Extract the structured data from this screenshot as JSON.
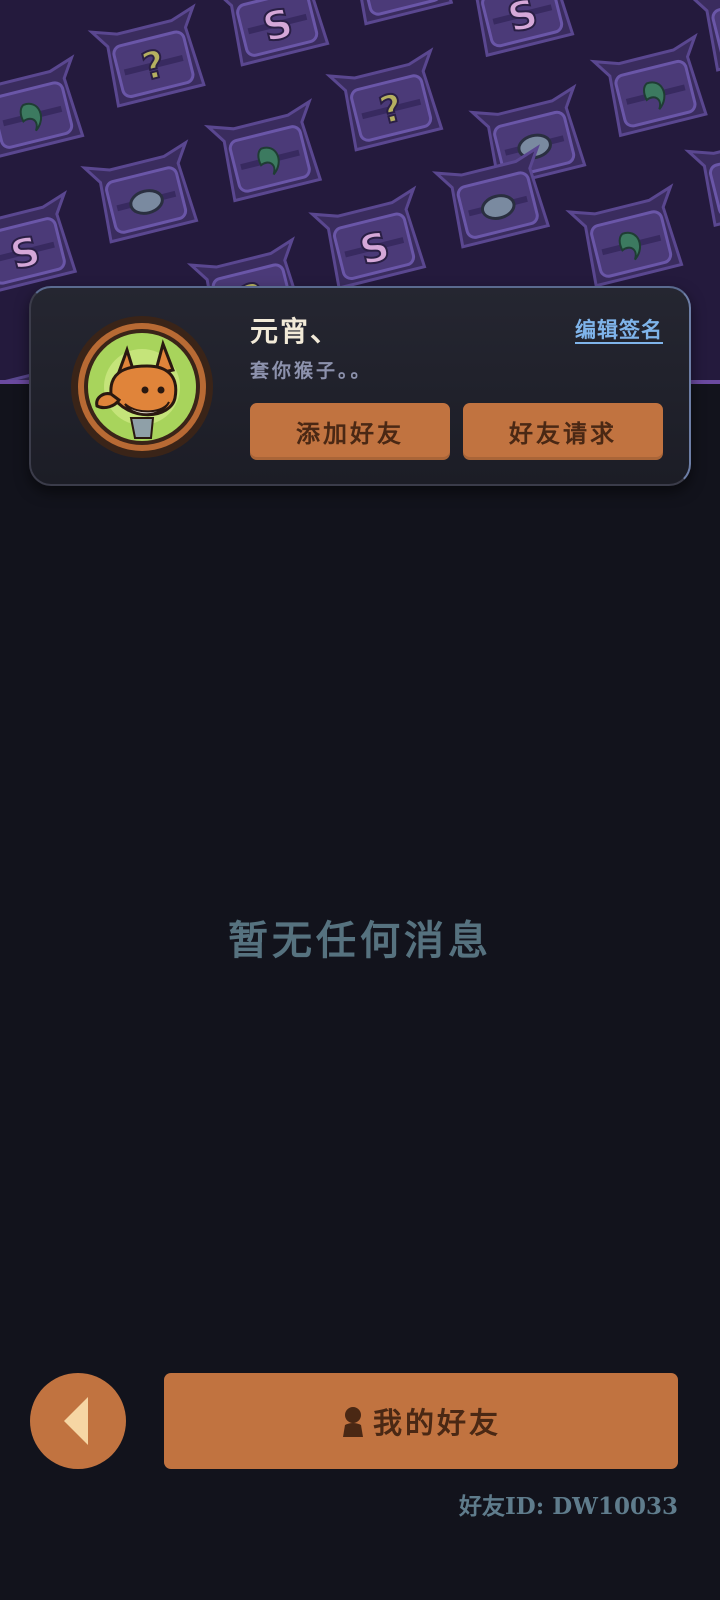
{
  "profile": {
    "username": "元宵、",
    "signature": "套你猴子。。",
    "edit_signature_label": "编辑签名",
    "add_friend_label": "添加好友",
    "friend_requests_label": "好友请求"
  },
  "main": {
    "empty_message": "暂无任何消息"
  },
  "footer": {
    "my_friends_label": "我的好友",
    "friend_id_text": "好友ID: DW10033"
  },
  "colors": {
    "banner_bg": "#241a3d",
    "page_bg": "#12131c",
    "accent_orange": "#c17340",
    "button_text": "#4a2814",
    "link_blue": "#7fb4ea",
    "muted_teal": "#56727f"
  },
  "icons": {
    "banner_pattern": [
      "chest-s-icon",
      "chest-question-icon",
      "chest-leaf-icon",
      "chest-orb-icon"
    ],
    "avatar": "fox-avatar-icon",
    "back": "back-arrow-icon",
    "friends": "person-icon"
  }
}
